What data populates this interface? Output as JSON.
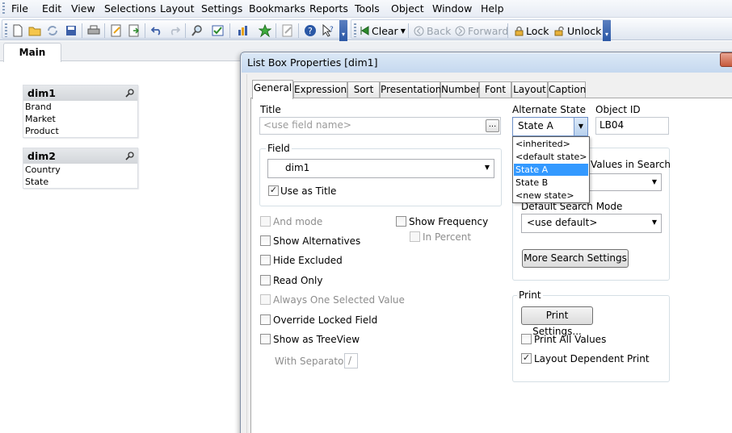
{
  "menubar": {
    "items": [
      "File",
      "Edit",
      "View",
      "Selections",
      "Layout",
      "Settings",
      "Bookmarks",
      "Reports",
      "Tools",
      "Object",
      "Window",
      "Help"
    ]
  },
  "toolbar": {
    "clear_label": "Clear",
    "back_label": "Back",
    "forward_label": "Forward",
    "lock_label": "Lock",
    "unlock_label": "Unlock"
  },
  "sheet": {
    "tab_label": "Main",
    "listboxes": [
      {
        "title": "dim1",
        "items": [
          "Brand",
          "Market",
          "Product"
        ]
      },
      {
        "title": "dim2",
        "items": [
          "Country",
          "State"
        ]
      }
    ]
  },
  "dialog": {
    "title": "List Box Properties [dim1]",
    "tabs": [
      "General",
      "Expressions",
      "Sort",
      "Presentation",
      "Number",
      "Font",
      "Layout",
      "Caption"
    ],
    "active_tab": "General",
    "title_label": "Title",
    "title_placeholder": "<use field name>",
    "dots_label": "...",
    "field_group_label": "Field",
    "field_value": "dim1",
    "use_as_title_label": "Use as Title",
    "use_as_title_checked": true,
    "alternate_state_label": "Alternate State",
    "alternate_state_value": "State A",
    "alternate_state_options": [
      "<inherited>",
      "<default state>",
      "State A",
      "State B",
      "<new state>"
    ],
    "object_id_label": "Object ID",
    "object_id_value": "LB04",
    "search_values_label": "Values in Search",
    "default_search_mode_label": "Default Search Mode",
    "default_search_mode_value": "<use default>",
    "more_search_settings_label": "More Search Settings",
    "left_options": [
      {
        "label": "And mode",
        "checked": false,
        "disabled": true
      },
      {
        "label": "Show Alternatives",
        "checked": false,
        "disabled": false
      },
      {
        "label": "Hide Excluded",
        "checked": false,
        "disabled": false
      },
      {
        "label": "Read Only",
        "checked": false,
        "disabled": false
      },
      {
        "label": "Always One Selected Value",
        "checked": false,
        "disabled": true
      },
      {
        "label": "Override Locked Field",
        "checked": false,
        "disabled": false
      },
      {
        "label": "Show as TreeView",
        "checked": false,
        "disabled": false
      }
    ],
    "show_frequency_label": "Show Frequency",
    "in_percent_label": "In Percent",
    "with_separator_label": "With Separator",
    "separator_value": "/",
    "print_group_label": "Print",
    "print_settings_label": "Print Settings...",
    "print_all_values_label": "Print All Values",
    "print_all_values_checked": false,
    "layout_dependent_print_label": "Layout Dependent Print",
    "layout_dependent_print_checked": true
  },
  "colors": {
    "selection_blue": "#3399ff",
    "toolbar_overflow": "#2b58a6"
  }
}
